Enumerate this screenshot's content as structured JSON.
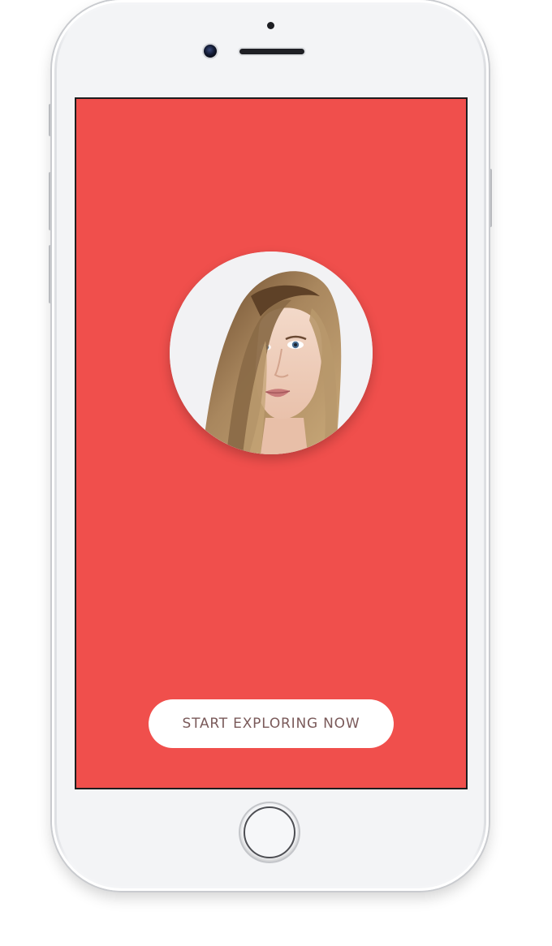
{
  "app": {
    "accent_color": "#f04f4c",
    "button_text_color": "#7a5a5a"
  },
  "device": {
    "model": "phone",
    "icons": {
      "front_camera": "camera-icon",
      "home_button": "home-button-icon"
    }
  },
  "welcome": {
    "avatar_alt": "profile-photo",
    "cta_label": "START EXPLORING NOW"
  }
}
